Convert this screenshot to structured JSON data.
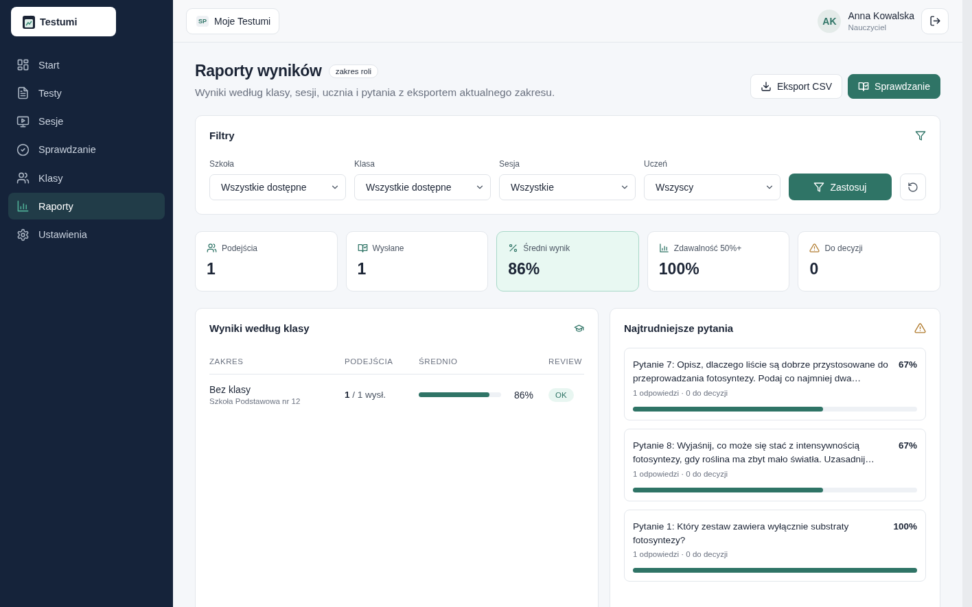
{
  "sidebar": {
    "logo": "Testumi",
    "items": [
      {
        "label": "Start",
        "selected": false
      },
      {
        "label": "Testy",
        "selected": false
      },
      {
        "label": "Sesje",
        "selected": false
      },
      {
        "label": "Sprawdzanie",
        "selected": false
      },
      {
        "label": "Klasy",
        "selected": false
      },
      {
        "label": "Raporty",
        "selected": true
      },
      {
        "label": "Ustawienia",
        "selected": false
      }
    ]
  },
  "topbar": {
    "workspace_badge": "SP",
    "workspace": "Moje Testumi",
    "user": {
      "initials": "AK",
      "name": "Anna Kowalska",
      "role": "Nauczyciel"
    }
  },
  "header": {
    "title": "Raporty wyników",
    "badge": "zakres roli",
    "subtitle": "Wyniki według klasy, sesji, ucznia i pytania z eksportem aktualnego zakresu.",
    "buttons": [
      {
        "label": "Eksport CSV",
        "kind": "secondary"
      },
      {
        "label": "Sprawdzanie",
        "kind": "primary"
      }
    ]
  },
  "filters": {
    "title": "Filtry",
    "fields": [
      {
        "label": "Szkoła",
        "value": "Wszystkie dostępne"
      },
      {
        "label": "Klasa",
        "value": "Wszystkie dostępne"
      },
      {
        "label": "Sesja",
        "value": "Wszystkie"
      },
      {
        "label": "Uczeń",
        "value": "Wszyscy"
      }
    ],
    "apply": "Zastosuj"
  },
  "stats": [
    {
      "label": "Podejścia",
      "value": "1",
      "selected": false
    },
    {
      "label": "Wysłane",
      "value": "1",
      "selected": false
    },
    {
      "label": "Średni wynik",
      "value": "86%",
      "selected": true
    },
    {
      "label": "Zdawalność 50%+",
      "value": "100%",
      "selected": false
    },
    {
      "label": "Do decyzji",
      "value": "0",
      "selected": false
    }
  ],
  "class_results": {
    "title": "Wyniki według klasy",
    "columns": [
      "ZAKRES",
      "PODEJŚCIA",
      "ŚREDNIO",
      "REVIEW"
    ],
    "rows": [
      {
        "name": "Bez klasy",
        "school": "Szkoła Podstawowa nr 12",
        "attempts": "**1** / 1 wysł.",
        "level": 0.86,
        "average": "86%",
        "review": "OK"
      }
    ]
  },
  "hard_questions": {
    "title": "Najtrudniejsze pytania",
    "items": [
      {
        "text": "Pytanie 7: Opisz, dlaczego liście są dobrze przystosowane do przeprowadzania fotosyntezy. Podaj co najmniej dwa…",
        "percent": "67%",
        "meta": "1 odpowiedzi · 0 do decyzji",
        "level": 0.67
      },
      {
        "text": "Pytanie 8: Wyjaśnij, co może się stać z intensywnością fotosyntezy, gdy roślina ma zbyt mało światła. Uzasadnij…",
        "percent": "67%",
        "meta": "1 odpowiedzi · 0 do decyzji",
        "level": 0.67
      },
      {
        "text": "Pytanie 1: Który zestaw zawiera wyłącznie substraty fotosyntezy?",
        "percent": "100%",
        "meta": "1 odpowiedzi · 0 do decyzji",
        "level": 1
      }
    ]
  }
}
